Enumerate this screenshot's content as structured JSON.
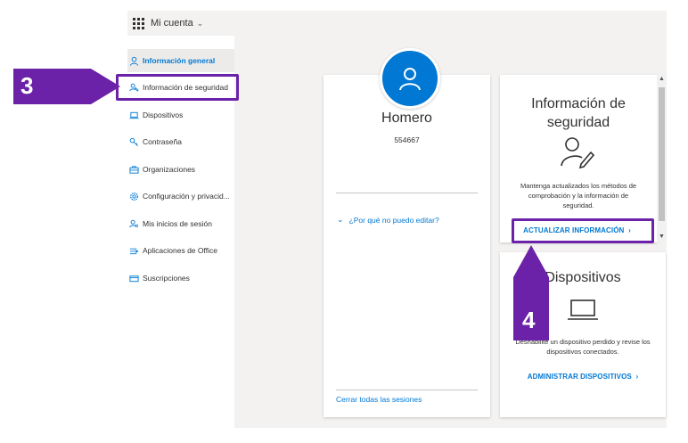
{
  "topbar": {
    "app_title": "Mi cuenta"
  },
  "sidebar": {
    "items": [
      {
        "label": "Información general",
        "icon": "person-icon"
      },
      {
        "label": "Información de seguridad",
        "icon": "person-key-icon"
      },
      {
        "label": "Dispositivos",
        "icon": "laptop-icon"
      },
      {
        "label": "Contraseña",
        "icon": "key-icon"
      },
      {
        "label": "Organizaciones",
        "icon": "briefcase-icon"
      },
      {
        "label": "Configuración y privacid...",
        "icon": "gear-icon"
      },
      {
        "label": "Mis inicios de sesión",
        "icon": "person-key-icon"
      },
      {
        "label": "Aplicaciones de Office",
        "icon": "apps-icon"
      },
      {
        "label": "Suscripciones",
        "icon": "card-icon"
      }
    ]
  },
  "profile": {
    "name": "Homero",
    "id": "554667",
    "why_link": "¿Por qué no puedo editar?",
    "signout_link": "Cerrar todas las sesiones"
  },
  "security_card": {
    "title_line1": "Información de",
    "title_line2": "seguridad",
    "desc_line1": "Mantenga actualizados los métodos de",
    "desc_line2": "comprobación y la información de",
    "desc_line3": "seguridad.",
    "link": "ACTUALIZAR INFORMACIÓN"
  },
  "devices_card": {
    "title": "Dispositivos",
    "desc_line1": "Deshabilite un dispositivo perdido y revise los",
    "desc_line2": "dispositivos conectados.",
    "link": "ADMINISTRAR DISPOSITIVOS"
  },
  "annotations": {
    "step3": "3",
    "step4": "4",
    "color": "#6b21a8"
  },
  "colors": {
    "accent": "#0078d4"
  }
}
